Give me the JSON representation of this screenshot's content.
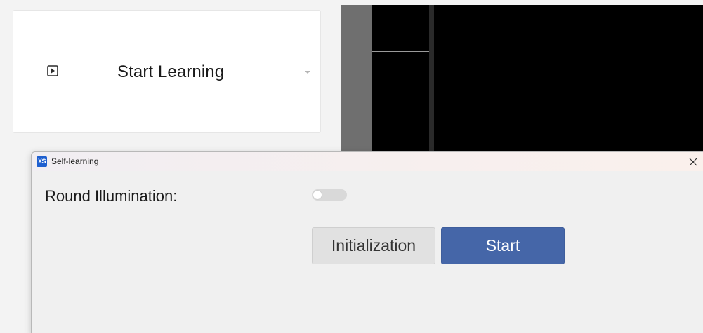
{
  "panel": {
    "title": "Start Learning",
    "icon": "play-square-icon",
    "expand_icon": "caret-down-icon"
  },
  "dialog": {
    "app_icon_text": "XS",
    "title": "Self-learning",
    "close_icon": "close-icon",
    "round_illumination_label": "Round Illumination:",
    "round_illumination_enabled": false,
    "init_button_label": "Initialization",
    "start_button_label": "Start"
  },
  "colors": {
    "accent": "#4566a8",
    "app_icon": "#1e5fcf",
    "viewer_bg": "#000000",
    "toggle_off": "#d9d9d9"
  }
}
